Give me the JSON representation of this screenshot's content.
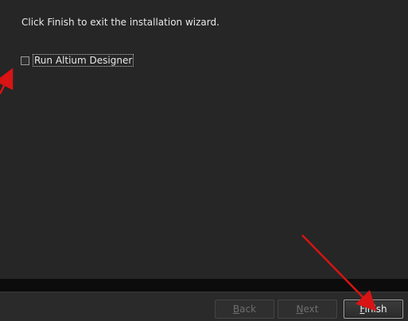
{
  "wizard": {
    "message": "Click Finish to exit the installation wizard.",
    "run_checkbox_label": "Run Altium Designer",
    "run_checkbox_checked": false
  },
  "buttons": {
    "back": "Back",
    "next": "Next",
    "finish": "Finish"
  },
  "annotation_color": "#d81414"
}
